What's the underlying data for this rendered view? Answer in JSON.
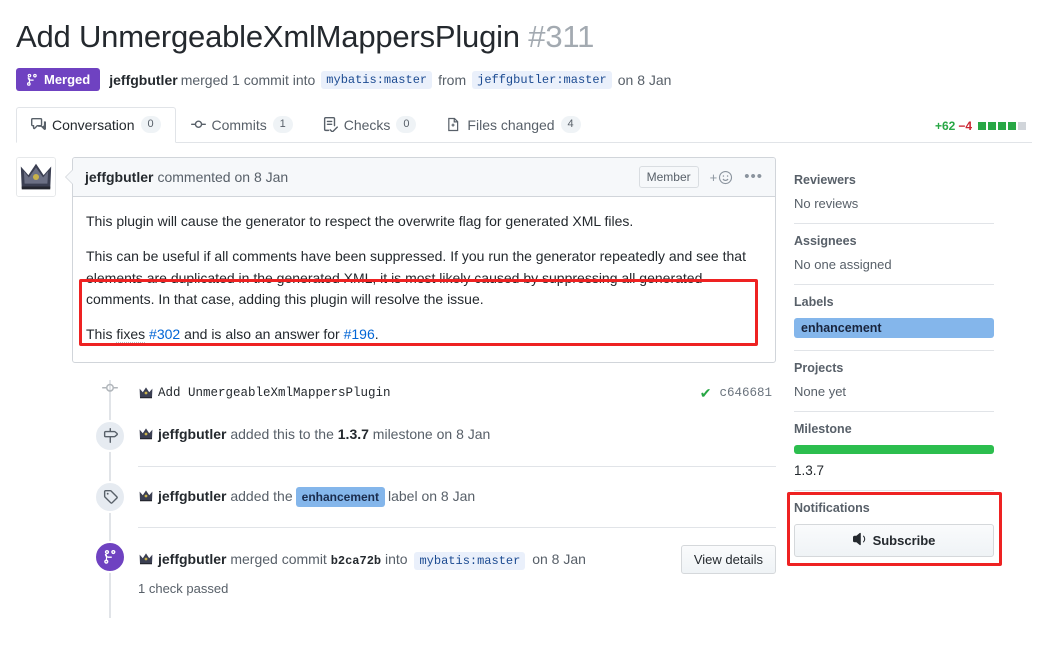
{
  "header": {
    "title": "Add UnmergeableXmlMappersPlugin",
    "number": "#311",
    "state_badge": "Merged",
    "state_icon": "git-merge-icon",
    "author": "jeffgbutler",
    "merged_text": "merged 1 commit into",
    "base_branch": "mybatis:master",
    "from_text": "from",
    "head_branch": "jeffgbutler:master",
    "date": "on 8 Jan"
  },
  "tabs": [
    {
      "label": "Conversation",
      "count": "0",
      "icon": "comment-discussion-icon",
      "active": true
    },
    {
      "label": "Commits",
      "count": "1",
      "icon": "git-commit-icon",
      "active": false
    },
    {
      "label": "Checks",
      "count": "0",
      "icon": "checklist-icon",
      "active": false
    },
    {
      "label": "Files changed",
      "count": "4",
      "icon": "file-diff-icon",
      "active": false
    }
  ],
  "diffstat": {
    "added": "+62",
    "deleted": "−4",
    "blocks_on": 4,
    "blocks_off": 1
  },
  "comment": {
    "avatar": "jeffgbutler-avatar",
    "author": "jeffgbutler",
    "action": "commented on 8 Jan",
    "association_badge": "Member",
    "reaction_icon": "add-reaction-icon",
    "menu_icon": "kebab-horizontal-icon",
    "paragraph1": "This plugin will cause the generator to respect the overwrite flag for generated XML files.",
    "highlighted_paragraph": "This can be useful if all comments have been suppressed. If you run the generator repeatedly and see that elements are duplicated in the generated XML, it is most likely caused by suppressing all generated comments. In that case, adding this plugin will resolve the issue.",
    "closing_prefix": "This ",
    "closing_fixes": "fixes",
    "closing_link1": "#302",
    "closing_mid": " and is also an answer for ",
    "closing_link2": "#196",
    "closing_suffix": "."
  },
  "timeline": {
    "commit": {
      "icon": "git-commit-dot-icon",
      "message": "Add UnmergeableXmlMappersPlugin",
      "status_icon": "check-icon",
      "sha": "c646681"
    },
    "milestone_event": {
      "icon": "milestone-icon",
      "actor": "jeffgbutler",
      "text_before": "added this to the",
      "milestone": "1.3.7",
      "text_after": "milestone on 8 Jan"
    },
    "label_event": {
      "icon": "tag-icon",
      "actor": "jeffgbutler",
      "text_before": "added the",
      "label": "enhancement",
      "text_after": "label on 8 Jan"
    },
    "merge_event": {
      "icon": "git-merge-icon",
      "actor": "jeffgbutler",
      "text_before": "merged commit",
      "sha": "b2ca72b",
      "into_text": "into",
      "branch": "mybatis:master",
      "date": "on 8 Jan",
      "button": "View details",
      "checks": "1 check passed"
    }
  },
  "sidebar": {
    "reviewers": {
      "title": "Reviewers",
      "empty": "No reviews"
    },
    "assignees": {
      "title": "Assignees",
      "empty": "No one assigned"
    },
    "labels": {
      "title": "Labels",
      "items": [
        "enhancement"
      ]
    },
    "projects": {
      "title": "Projects",
      "empty": "None yet"
    },
    "milestone": {
      "title": "Milestone",
      "name": "1.3.7",
      "progress": 100
    },
    "notifications": {
      "title": "Notifications",
      "button": "Subscribe",
      "icon": "unmute-icon"
    }
  },
  "colors": {
    "merged_purple": "#6f42c1",
    "added_green": "#28a745",
    "deleted_red": "#cb2431",
    "label_blue": "#84b6eb",
    "annotation_red": "#ee2222",
    "link_blue": "#0366d6"
  }
}
